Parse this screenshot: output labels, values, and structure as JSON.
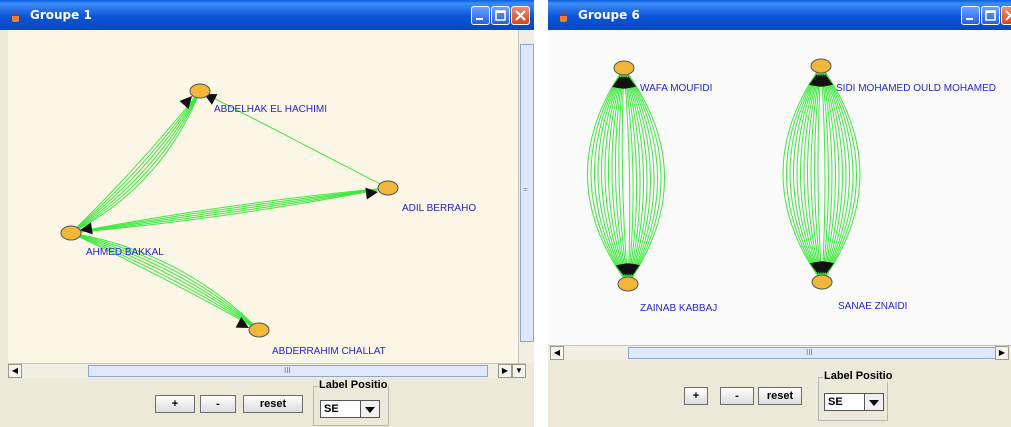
{
  "windows": [
    {
      "title": "Groupe 1",
      "nodes": [
        {
          "label": "ABDELHAK EL HACHIMI"
        },
        {
          "label": "ADIL BERRAHO"
        },
        {
          "label": "AHMED BAKKAL"
        },
        {
          "label": "ABDERRAHIM CHALLAT"
        }
      ],
      "controls": {
        "zoom_in": "+",
        "zoom_out": "-",
        "reset": "reset",
        "label_position_title": "Label Positio",
        "label_position_value": "SE"
      },
      "scroll_grip": "III"
    },
    {
      "title": "Groupe 6",
      "nodes": [
        {
          "label": "WAFA MOUFIDI"
        },
        {
          "label": "SIDI MOHAMED OULD MOHAMED"
        },
        {
          "label": "ZAINAB KABBAJ"
        },
        {
          "label": "SANAE ZNAIDI"
        }
      ],
      "controls": {
        "zoom_in": "+",
        "zoom_out": "-",
        "reset": "reset",
        "label_position_title": "Label Positio",
        "label_position_value": "SE"
      },
      "scroll_grip": "III"
    }
  ],
  "colors": {
    "edge": "#3ee83e",
    "node_fill": "#f2b73a",
    "label": "#2424d6",
    "titlebar": "#0a55d8"
  }
}
